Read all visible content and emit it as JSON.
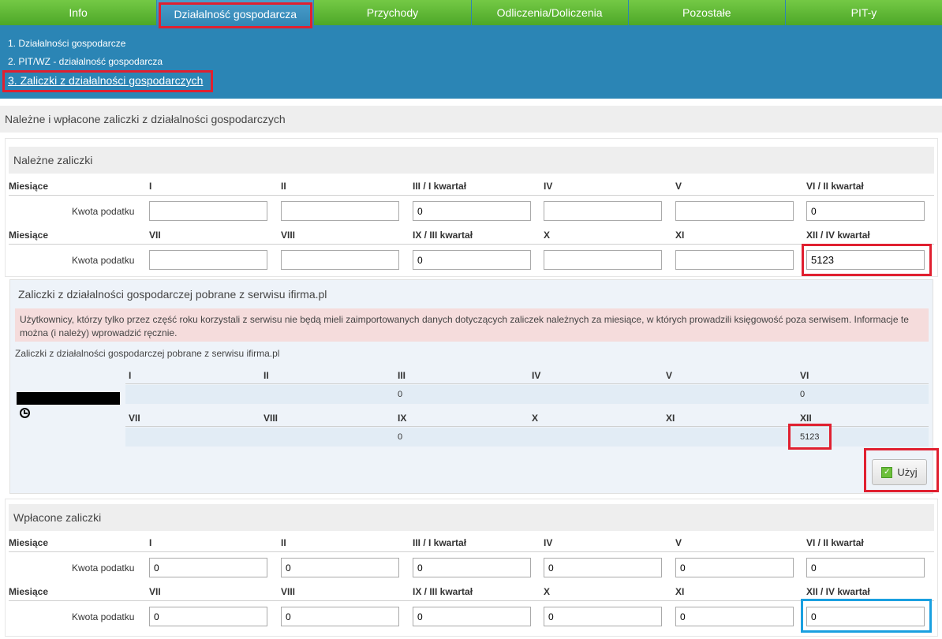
{
  "nav": {
    "tabs": [
      "Info",
      "Działalność gospodarcza",
      "Przychody",
      "Odliczenia/Doliczenia",
      "Pozostałe",
      "PIT-y"
    ],
    "active_index": 1
  },
  "subnav": {
    "items": [
      "1. Działalności gospodarcze",
      "2. PIT/WZ - działalność gospodarcza",
      "3. Zaliczki z działalności gospodarczych"
    ]
  },
  "page_title": "Należne i wpłacone zaliczki z działalności gospodarczych",
  "due": {
    "title": "Należne zaliczki",
    "months_label": "Miesiące",
    "amount_label": "Kwota podatku",
    "row1_headers": [
      "I",
      "II",
      "III / I kwartał",
      "IV",
      "V",
      "VI / II kwartał"
    ],
    "row1_values": [
      "",
      "",
      "0",
      "",
      "",
      "0"
    ],
    "row2_headers": [
      "VII",
      "VIII",
      "IX / III kwartał",
      "X",
      "XI",
      "XII / IV kwartał"
    ],
    "row2_values": [
      "",
      "",
      "0",
      "",
      "",
      "5123"
    ]
  },
  "imported": {
    "title": "Zaliczki z działalności gospodarczej pobrane z serwisu ifirma.pl",
    "warning": "Użytkownicy, którzy tylko przez część roku korzystali z serwisu nie będą mieli zaimportowanych danych dotyczących zaliczek należnych za miesiące, w których prowadzili księgowość poza serwisem. Informacje te można (i należy) wprowadzić ręcznie.",
    "subtitle": "Zaliczki z działalności gospodarczej pobrane z serwisu ifirma.pl",
    "row1_headers": [
      "I",
      "II",
      "III",
      "IV",
      "V",
      "VI"
    ],
    "row1_values": [
      "",
      "",
      "0",
      "",
      "",
      "0"
    ],
    "row2_headers": [
      "VII",
      "VIII",
      "IX",
      "X",
      "XI",
      "XII"
    ],
    "row2_values": [
      "",
      "",
      "0",
      "",
      "",
      "5123"
    ],
    "use_button": "Użyj"
  },
  "paid": {
    "title": "Wpłacone zaliczki",
    "months_label": "Miesiące",
    "amount_label": "Kwota podatku",
    "row1_headers": [
      "I",
      "II",
      "III / I kwartał",
      "IV",
      "V",
      "VI / II kwartał"
    ],
    "row1_values": [
      "0",
      "0",
      "0",
      "0",
      "0",
      "0"
    ],
    "row2_headers": [
      "VII",
      "VIII",
      "IX / III kwartał",
      "X",
      "XI",
      "XII / IV kwartał"
    ],
    "row2_values": [
      "0",
      "0",
      "0",
      "0",
      "0",
      "0"
    ]
  }
}
